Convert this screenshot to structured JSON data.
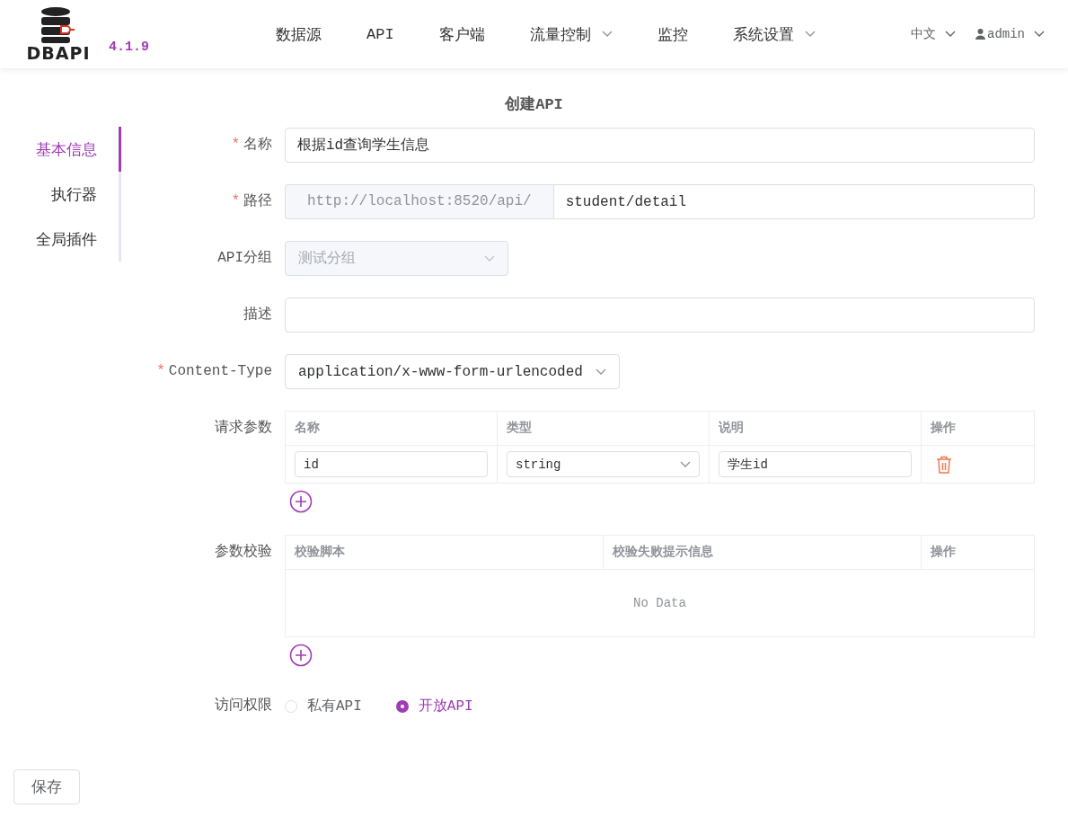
{
  "header": {
    "logo_text": "DBAPI",
    "version": "4.1.9",
    "nav": [
      {
        "label": "数据源",
        "dropdown": false
      },
      {
        "label": "API",
        "dropdown": false
      },
      {
        "label": "客户端",
        "dropdown": false
      },
      {
        "label": "流量控制",
        "dropdown": true
      },
      {
        "label": "监控",
        "dropdown": false
      },
      {
        "label": "系统设置",
        "dropdown": true
      }
    ],
    "language": "中文",
    "user": "admin"
  },
  "page_title": "创建API",
  "side_tabs": [
    {
      "label": "基本信息",
      "selected": true
    },
    {
      "label": "执行器",
      "selected": false
    },
    {
      "label": "全局插件",
      "selected": false
    }
  ],
  "fields": [
    {
      "kind": "text",
      "label": "名称",
      "required_mark": "*",
      "value": "根据id查询学生信息"
    },
    {
      "kind": "url",
      "label": "路径",
      "required_mark": "*",
      "prefix": "http://localhost:8520/api/",
      "value": "student/detail"
    },
    {
      "kind": "select",
      "label": "API分组",
      "value": "测试分组",
      "disabled": true
    },
    {
      "kind": "text",
      "label": "描述"
    },
    {
      "kind": "select",
      "label": "Content-Type",
      "required_mark": "*",
      "value": "application/x-www-form-urlencoded",
      "disabled": false
    },
    {
      "kind": "table",
      "label": "请求参数",
      "columns": [
        "名称",
        "类型",
        "说明",
        "操作"
      ],
      "rows": [
        {
          "name": "id",
          "type": "string",
          "note": "学生id"
        }
      ]
    },
    {
      "kind": "table",
      "label": "参数校验",
      "columns": [
        "校验脚本",
        "校验失败提示信息",
        "操作"
      ],
      "empty_text": "No Data"
    },
    {
      "kind": "radio",
      "label": "访问权限",
      "options": [
        {
          "label": "私有API",
          "selected": false
        },
        {
          "label": "开放API",
          "selected": true
        }
      ]
    }
  ],
  "save_button": "保存"
}
